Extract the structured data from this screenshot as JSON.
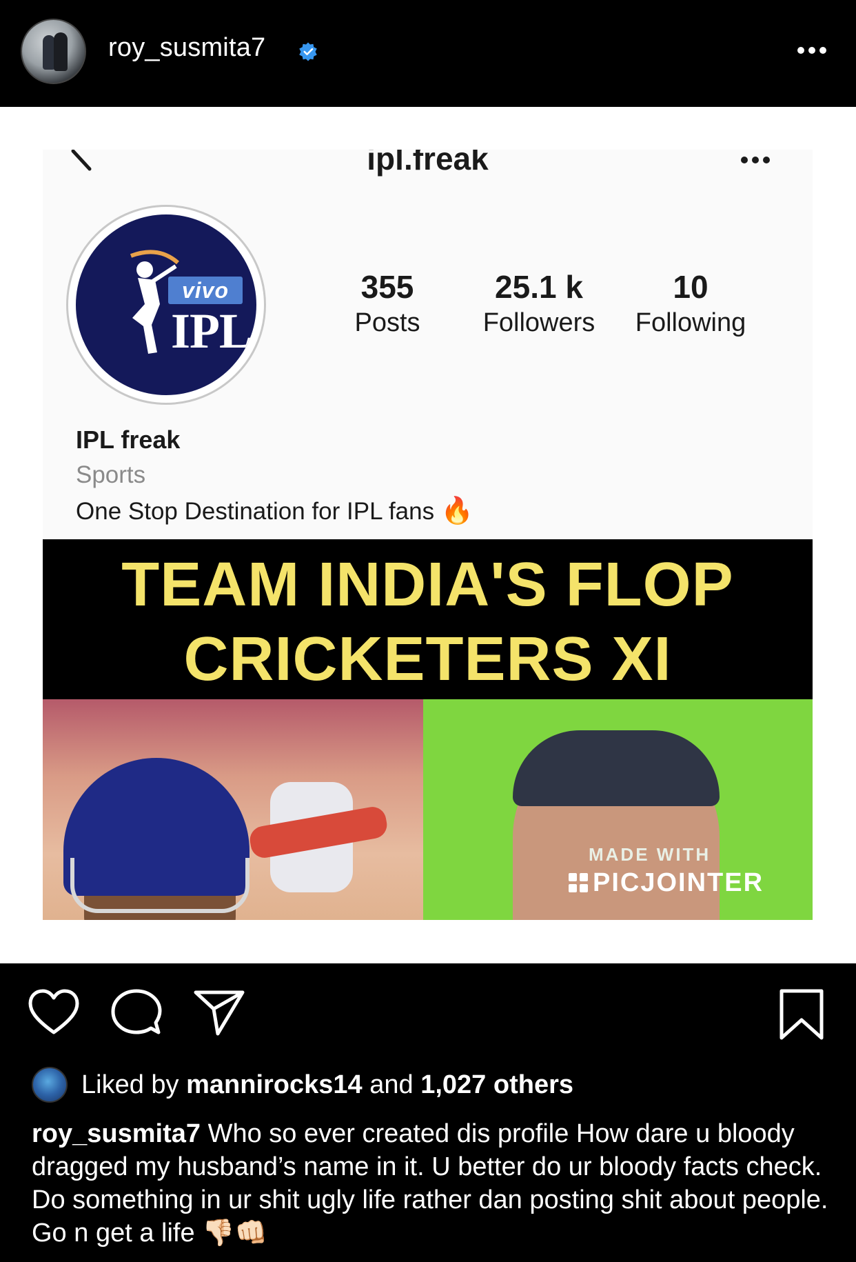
{
  "post": {
    "username": "roy_susmita7",
    "verified": true
  },
  "screenshot": {
    "title": "ipl.freak",
    "avatar": {
      "vivo": "vivo",
      "ipl": "IPL"
    },
    "stats": {
      "posts_value": "355",
      "posts_label": "Posts",
      "followers_value": "25.1 k",
      "followers_label": "Followers",
      "following_value": "10",
      "following_label": "Following"
    },
    "name": "IPL freak",
    "category": "Sports",
    "bio": "One Stop Destination for IPL fans",
    "bio_emoji": "🔥",
    "thumbnail": {
      "title_line1": "TEAM INDIA'S FLOP",
      "title_line2": "CRICKETERS XI",
      "watermark_top": "MADE WITH",
      "watermark_brand": "PICJOINTER"
    }
  },
  "likes": {
    "prefix": "Liked by",
    "user": "mannirocks14",
    "connector": "and",
    "others": "1,027 others"
  },
  "caption": {
    "user": "roy_susmita7",
    "text": "Who so ever created dis profile How dare u bloody dragged my husband’s name in it. U better do ur bloody facts check. Do something in ur shit ugly life rather dan posting shit about people. Go n get a life 👎🏻👊🏻"
  },
  "colors": {
    "background": "#000000",
    "verified_badge": "#3897f0",
    "thumb_title": "#f4e36a",
    "ipl_navy": "#14195a"
  }
}
